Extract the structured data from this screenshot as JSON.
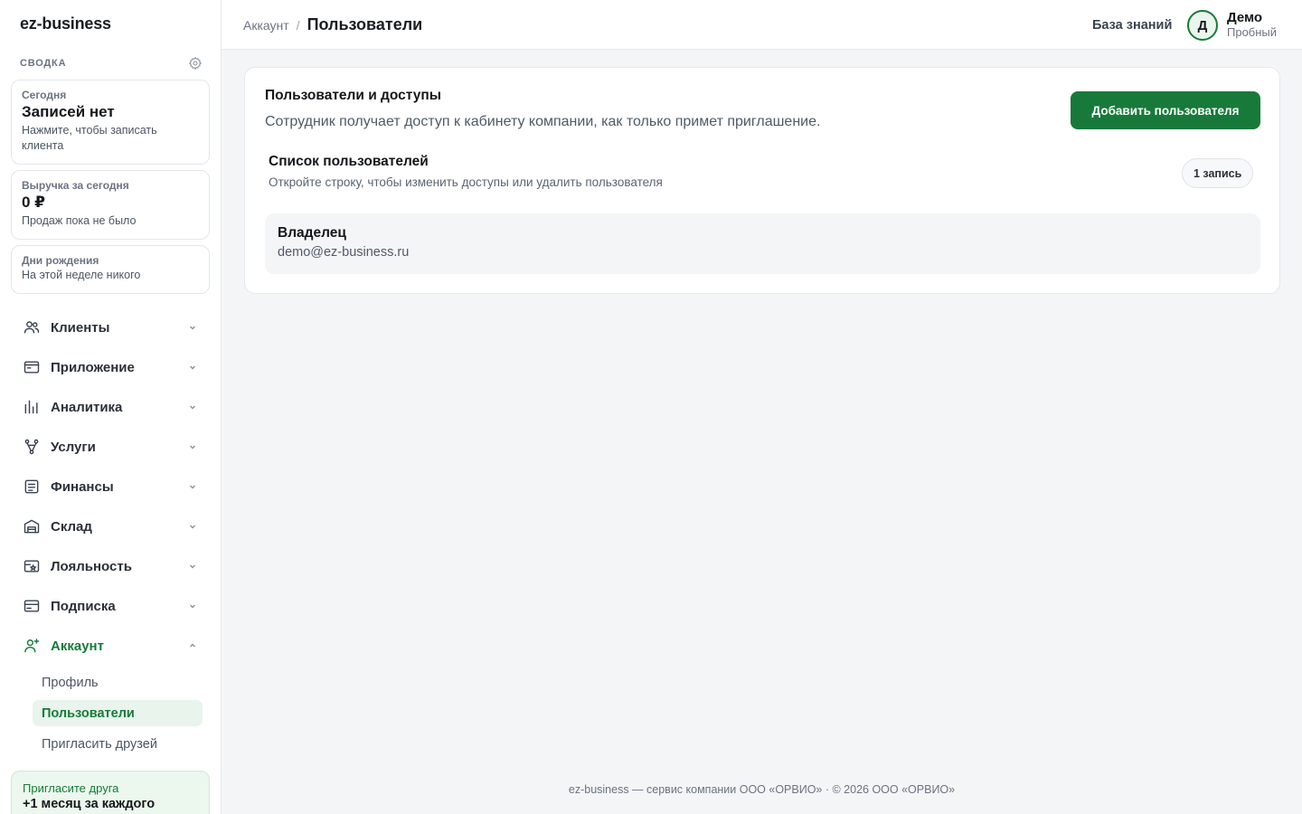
{
  "app": {
    "logo": "ez-business"
  },
  "sidebar": {
    "summary_title": "СВОДКА",
    "cards": [
      {
        "label": "Сегодня",
        "big": "Записей нет",
        "note": "Нажмите, чтобы записать клиента"
      },
      {
        "label": "Выручка за сегодня",
        "big": "0 ₽",
        "note": "Продаж пока не было"
      },
      {
        "label": "Дни рождения",
        "note": "На этой неделе никого"
      }
    ],
    "nav": [
      {
        "label": "Клиенты",
        "icon": "users-icon",
        "expanded": false
      },
      {
        "label": "Приложение",
        "icon": "app-icon",
        "expanded": false
      },
      {
        "label": "Аналитика",
        "icon": "analytics-icon",
        "expanded": false
      },
      {
        "label": "Услуги",
        "icon": "services-icon",
        "expanded": false
      },
      {
        "label": "Финансы",
        "icon": "finance-icon",
        "expanded": false
      },
      {
        "label": "Склад",
        "icon": "warehouse-icon",
        "expanded": false
      },
      {
        "label": "Лояльность",
        "icon": "loyalty-icon",
        "expanded": false
      },
      {
        "label": "Подписка",
        "icon": "subscription-icon",
        "expanded": false
      },
      {
        "label": "Аккаунт",
        "icon": "account-icon",
        "expanded": true
      }
    ],
    "account_sub": [
      {
        "label": "Профиль",
        "active": false
      },
      {
        "label": "Пользователи",
        "active": true
      },
      {
        "label": "Пригласить друзей",
        "active": false
      }
    ],
    "promo": {
      "title": "Пригласите друга",
      "big": "+1 месяц за каждого"
    }
  },
  "topbar": {
    "breadcrumb_parent": "Аккаунт",
    "breadcrumb_sep": "/",
    "breadcrumb_current": "Пользователи",
    "kb_link": "База знаний",
    "user": {
      "avatar_letter": "Д",
      "name": "Демо",
      "plan": "Пробный"
    }
  },
  "main": {
    "title": "Пользователи и доступы",
    "description": "Сотрудник получает доступ к кабинету компании, как только примет приглашение.",
    "add_button": "Добавить пользователя",
    "list_title": "Список пользователей",
    "list_subtitle": "Откройте строку, чтобы изменить доступы или удалить пользователя",
    "count_badge": "1 запись",
    "users": [
      {
        "role": "Владелец",
        "email": "demo@ez-business.ru"
      }
    ]
  },
  "footer": {
    "text": "ez-business — сервис компании ООО «ОРВИО» · © 2026 ООО «ОРВИО»"
  },
  "colors": {
    "accent": "#177a3a",
    "accent_bg": "#e8f4ec",
    "background": "#f4f5f7"
  }
}
